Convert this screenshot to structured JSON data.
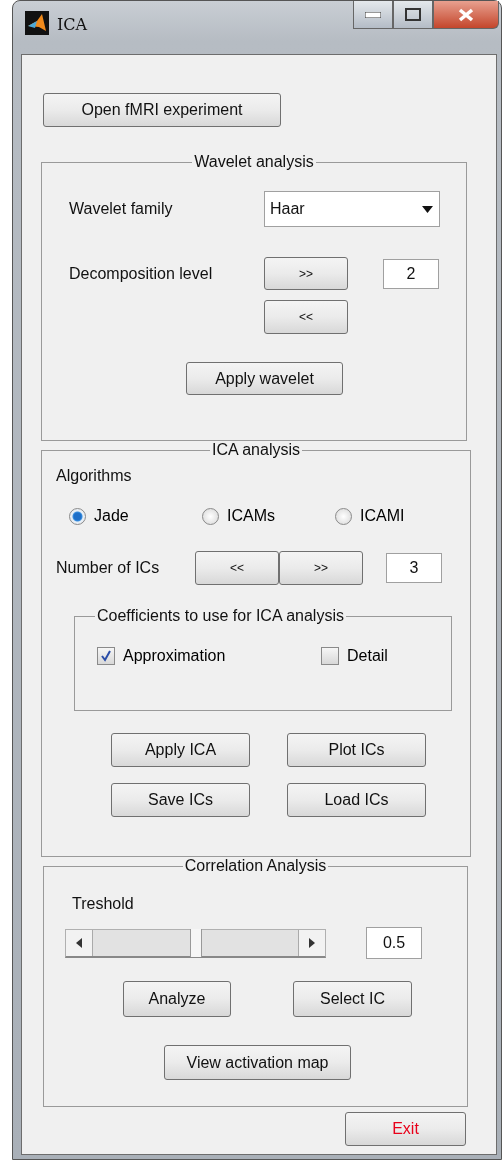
{
  "window": {
    "title": "ICA"
  },
  "open_button": "Open fMRI experiment",
  "wavelet": {
    "title": "Wavelet analysis",
    "family_label": "Wavelet family",
    "family_value": "Haar",
    "level_label": "Decomposition level",
    "up_button": ">>",
    "down_button": "<<",
    "level_value": "2",
    "apply_button": "Apply wavelet"
  },
  "ica": {
    "title": "ICA analysis",
    "algorithms_label": "Algorithms",
    "algorithms": [
      {
        "label": "Jade",
        "selected": true
      },
      {
        "label": "ICAMs",
        "selected": false
      },
      {
        "label": "ICAMI",
        "selected": false
      }
    ],
    "ics_label": "Number of ICs",
    "ics_down": "<<",
    "ics_up": ">>",
    "ics_value": "3",
    "coefficients": {
      "title": "Coefficients to use for ICA analysis",
      "options": [
        {
          "label": "Approximation",
          "checked": true
        },
        {
          "label": "Detail",
          "checked": false
        }
      ]
    },
    "buttons": [
      "Apply ICA",
      "Plot ICs",
      "Save ICs",
      "Load ICs"
    ]
  },
  "correlation": {
    "title": "Correlation Analysis",
    "threshold_label": "Treshold",
    "slider": {
      "level": 0.5
    },
    "threshold_value": "0.5",
    "buttons": [
      "Analyze",
      "Select IC"
    ],
    "map_button": "View activation map"
  },
  "exit_button": "Exit"
}
